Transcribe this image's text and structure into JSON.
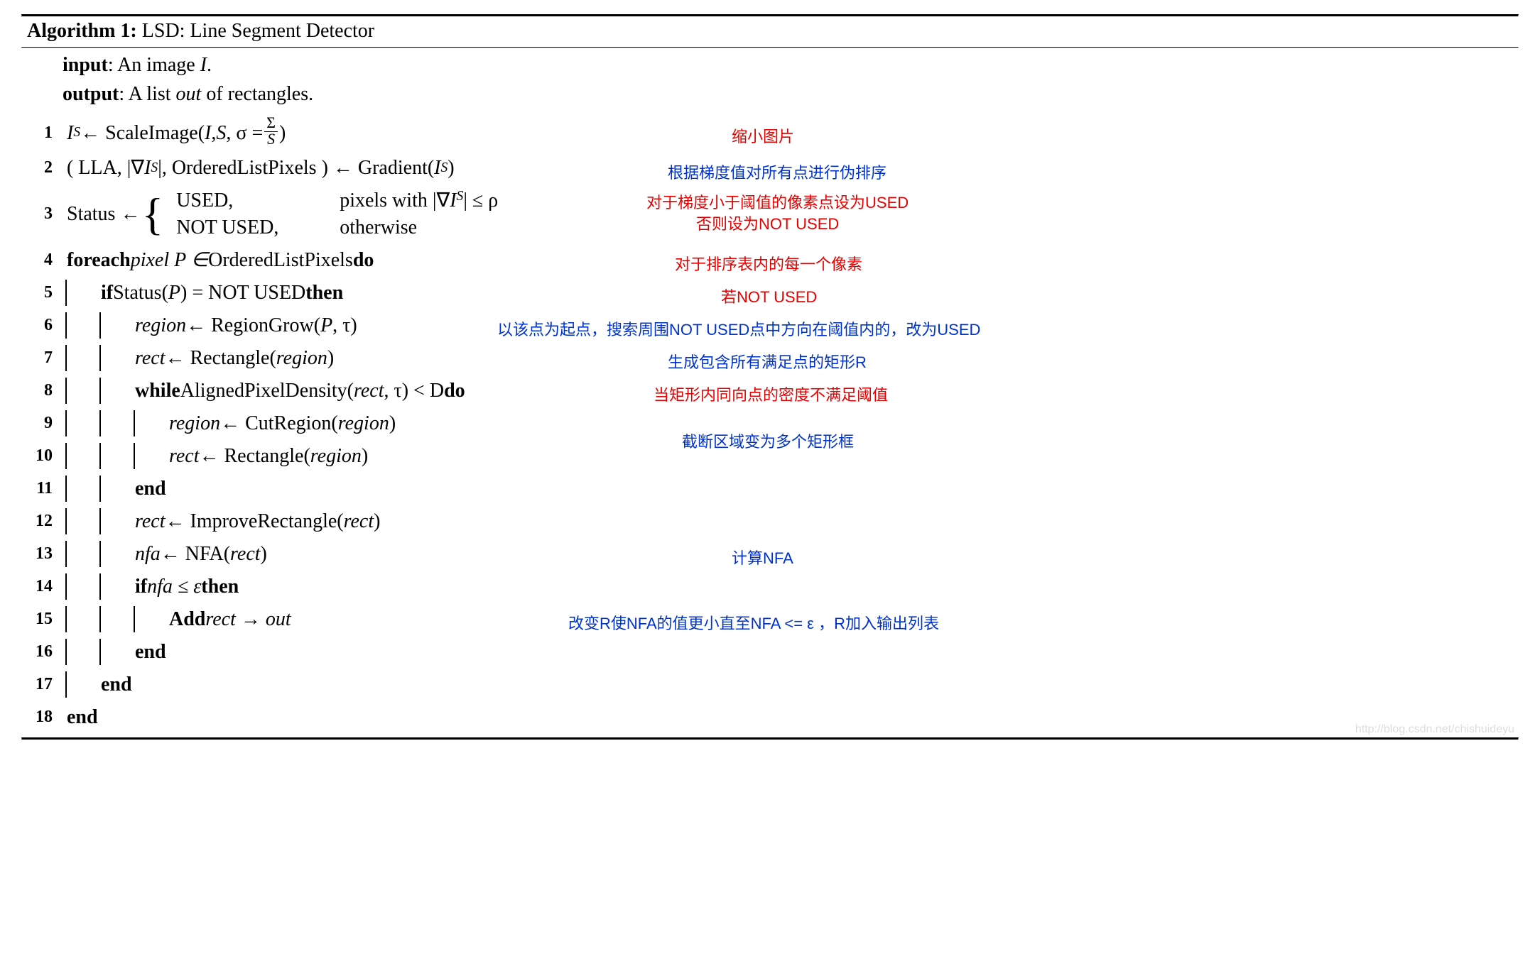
{
  "header": {
    "label": "Algorithm 1:",
    "title": "LSD: Line Segment Detector"
  },
  "io": {
    "input_label": "input",
    "input_text": ": An image ",
    "input_var": "I",
    "input_tail": ".",
    "output_label": "output",
    "output_text": ": A list ",
    "output_var": "out",
    "output_tail": " of rectangles."
  },
  "lines": {
    "n1": "1",
    "n2": "2",
    "n3": "3",
    "n4": "4",
    "n5": "5",
    "n6": "6",
    "n7": "7",
    "n8": "8",
    "n9": "9",
    "n10": "10",
    "n11": "11",
    "n12": "12",
    "n13": "13",
    "n14": "14",
    "n15": "15",
    "n16": "16",
    "n17": "17",
    "n18": "18"
  },
  "code": {
    "l1_a": "I",
    "l1_b": " ← ScaleImage(",
    "l1_c": "I",
    "l1_d": ", ",
    "l1_e": "S",
    "l1_f": ", σ = ",
    "l1_g": ")",
    "frac_num": "Σ",
    "frac_den": "S",
    "l2": "( LLA, |∇",
    "l2_a": "I",
    "l2_b": "|, OrderedListPixels ) ← Gradient(",
    "l2_c": "I",
    "l2_d": ")",
    "l3_a": "Status ← ",
    "l3_used": "USED,",
    "l3_used_cond_a": "pixels with |∇",
    "l3_used_cond_b": "I",
    "l3_used_cond_c": "| ≤ ρ",
    "l3_not": "NOT USED,",
    "l3_not_cond": "otherwise",
    "l4_a": "foreach ",
    "l4_b": "pixel P ∈ ",
    "l4_c": "OrderedListPixels",
    "l4_d": " do",
    "l5_a": "if ",
    "l5_b": "Status(",
    "l5_c": "P",
    "l5_d": ") = NOT USED",
    "l5_e": " then",
    "l6_a": "region",
    "l6_b": " ← RegionGrow(",
    "l6_c": "P",
    "l6_d": ", τ)",
    "l7_a": "rect",
    "l7_b": " ← Rectangle(",
    "l7_c": "region",
    "l7_d": ")",
    "l8_a": "while ",
    "l8_b": "AlignedPixelDensity(",
    "l8_c": "rect",
    "l8_d": ", τ) < D",
    "l8_e": " do",
    "l9_a": "region",
    "l9_b": " ← CutRegion(",
    "l9_c": "region",
    "l9_d": ")",
    "l10_a": "rect",
    "l10_b": " ← Rectangle(",
    "l10_c": "region",
    "l10_d": ")",
    "l11": "end",
    "l12_a": "rect",
    "l12_b": " ← ImproveRectangle(",
    "l12_c": "rect",
    "l12_d": ")",
    "l13_a": "nfa",
    "l13_b": " ← NFA(",
    "l13_c": "rect",
    "l13_d": ")",
    "l14_a": "if ",
    "l14_b": "nfa ≤ ε",
    "l14_c": " then",
    "l15_a": "Add ",
    "l15_b": "rect → out",
    "l16": "end",
    "l17": "end",
    "l18": "end"
  },
  "annotations": {
    "a1": "缩小图片",
    "a2": "根据梯度值对所有点进行伪排序",
    "a3a": "对于梯度小于阈值的像素点设为USED",
    "a3b": "否则设为NOT USED",
    "a4": "对于排序表内的每一个像素",
    "a5": "若NOT USED",
    "a6": "以该点为起点，搜索周围NOT USED点中方向在阈值内的，改为USED",
    "a7": "生成包含所有满足点的矩形R",
    "a8": "当矩形内同向点的密度不满足阈值",
    "a9": "截断区域变为多个矩形框",
    "a13": "计算NFA",
    "a15": "改变R使NFA的值更小直至NFA <= ε ，R加入输出列表"
  },
  "watermark": "http://blog.csdn.net/chishuideyu"
}
